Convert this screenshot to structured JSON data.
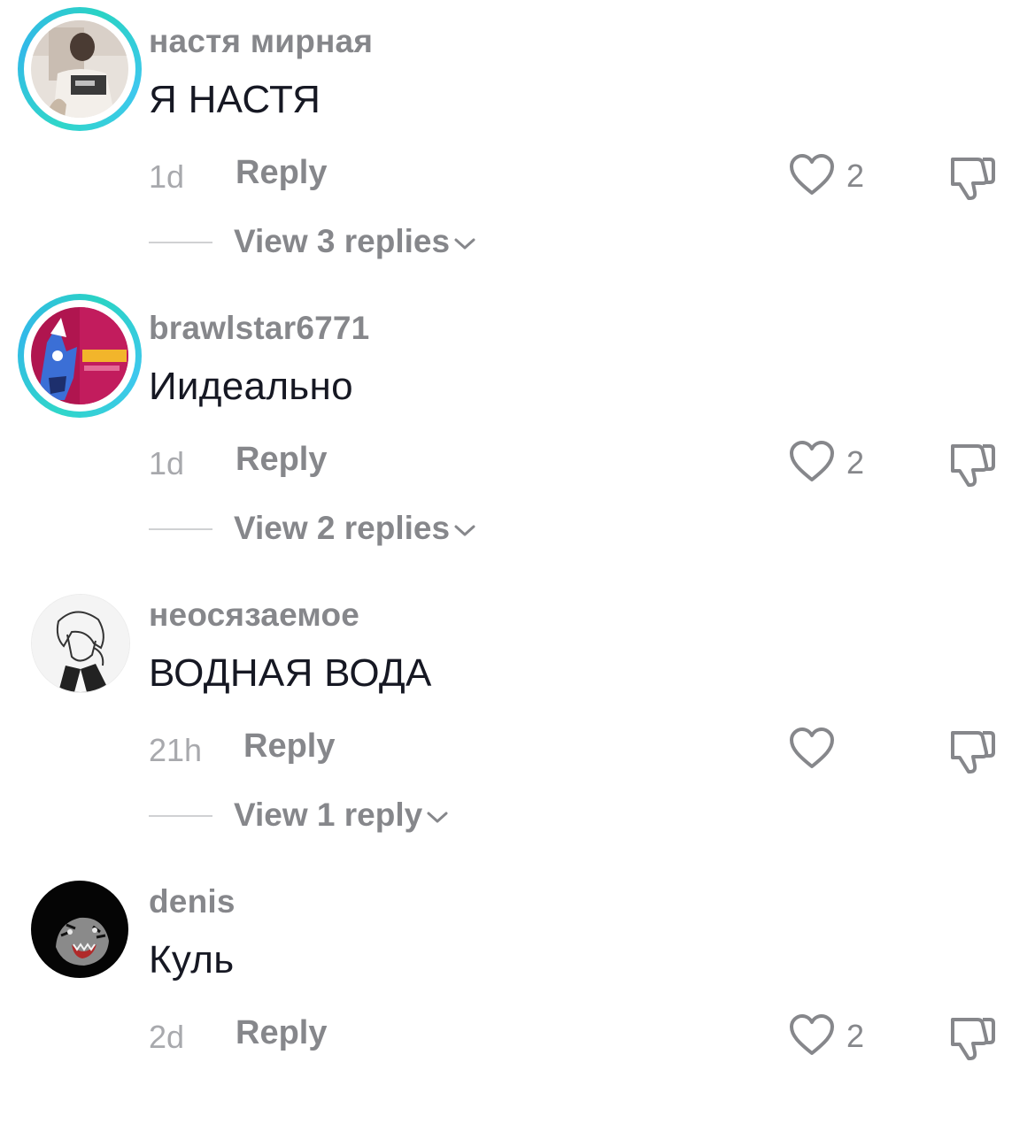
{
  "comments": [
    {
      "username": "настя мирная",
      "text": "Я НАСТЯ",
      "time": "1d",
      "reply_label": "Reply",
      "likes": "2",
      "view_replies": "View 3 replies",
      "has_story": true
    },
    {
      "username": "brawlstar6771",
      "text": "Иидеально",
      "time": "1d",
      "reply_label": "Reply",
      "likes": "2",
      "view_replies": "View 2 replies",
      "has_story": true
    },
    {
      "username": "неосязаемое",
      "text": "ВОДНАЯ ВОДА",
      "time": "21h",
      "reply_label": "Reply",
      "likes": "",
      "view_replies": "View 1 reply",
      "has_story": false
    },
    {
      "username": "denis",
      "text": "Куль",
      "time": "2d",
      "reply_label": "Reply",
      "likes": "2",
      "view_replies": "",
      "has_story": false
    }
  ],
  "colors": {
    "story_ring": "#33c7e0",
    "username": "#86878b",
    "text": "#161823",
    "muted": "#a8a9ad"
  },
  "icons": {
    "like": "heart-outline-icon",
    "dislike": "thumbs-down-outline-icon",
    "expand": "chevron-down-icon"
  }
}
